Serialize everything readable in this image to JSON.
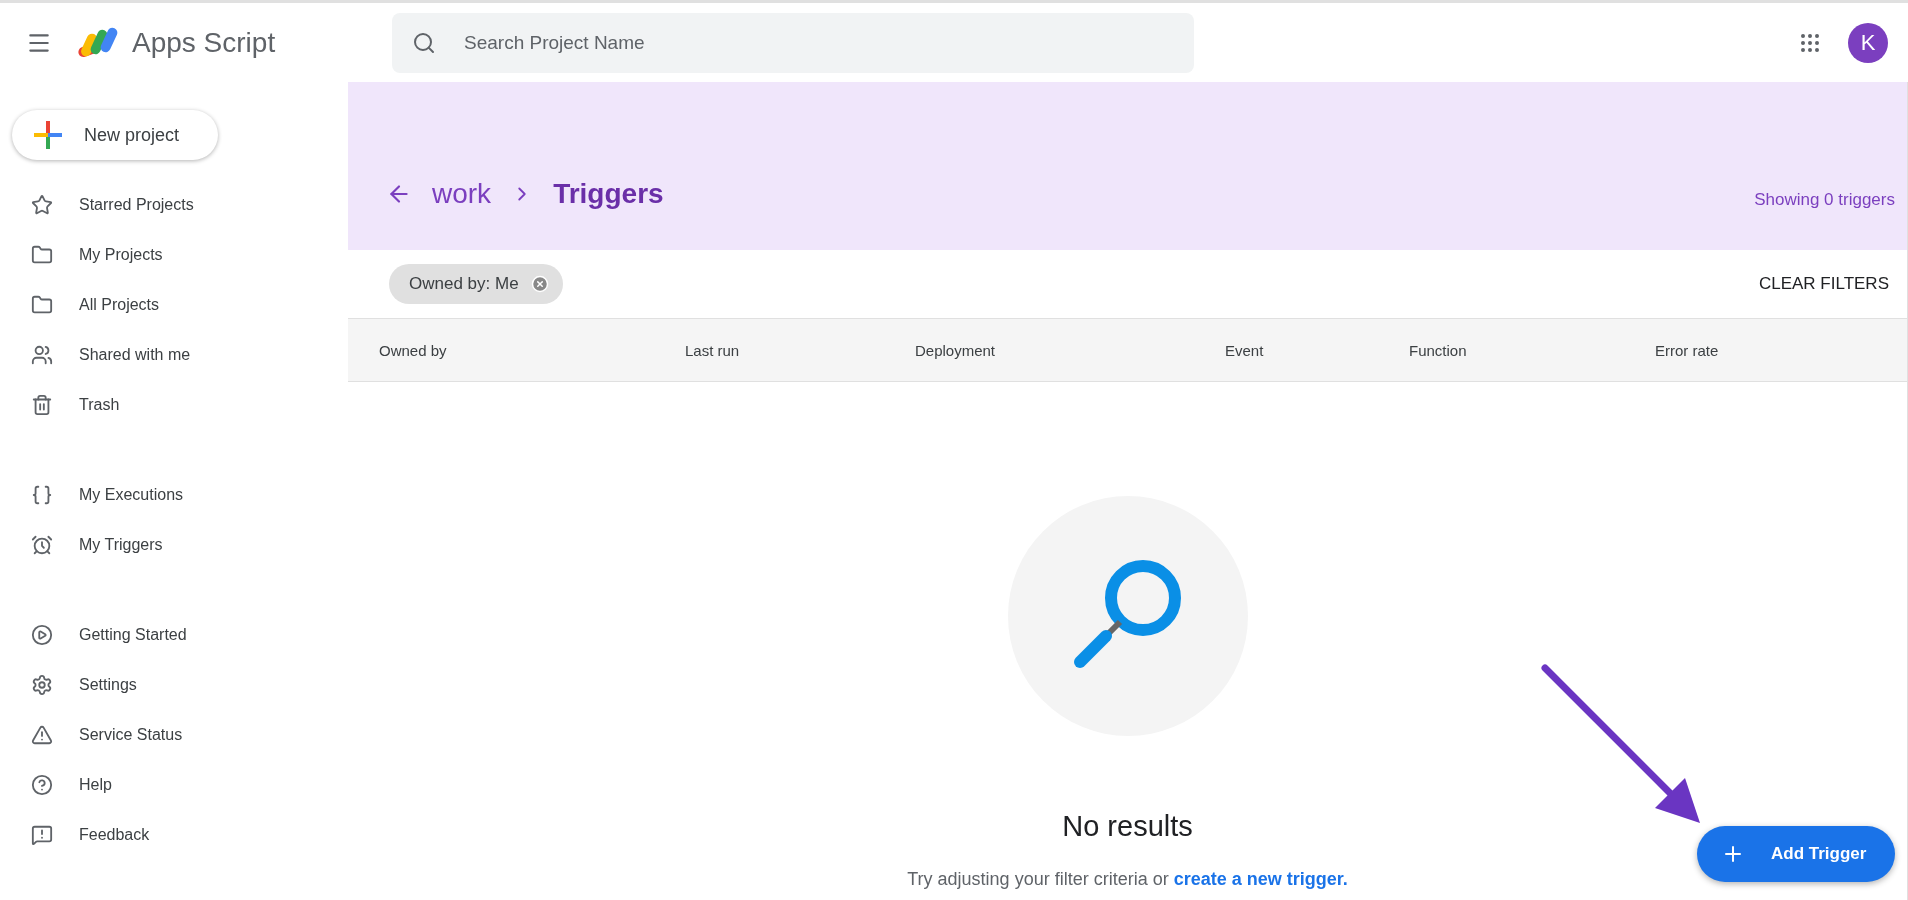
{
  "app": {
    "name": "Apps Script"
  },
  "search": {
    "placeholder": "Search Project Name"
  },
  "account": {
    "initial": "K"
  },
  "new_project": {
    "label": "New project"
  },
  "sidebar": {
    "groups": [
      {
        "items": [
          {
            "label": "Starred Projects"
          },
          {
            "label": "My Projects"
          },
          {
            "label": "All Projects"
          },
          {
            "label": "Shared with me"
          },
          {
            "label": "Trash"
          }
        ]
      },
      {
        "items": [
          {
            "label": "My Executions"
          },
          {
            "label": "My Triggers"
          }
        ]
      },
      {
        "items": [
          {
            "label": "Getting Started"
          },
          {
            "label": "Settings"
          },
          {
            "label": "Service Status"
          },
          {
            "label": "Help"
          },
          {
            "label": "Feedback"
          }
        ]
      }
    ]
  },
  "breadcrumb": {
    "parent": "work",
    "current": "Triggers"
  },
  "count": "Showing 0 triggers",
  "filters": [
    {
      "label": "Owned by: Me"
    }
  ],
  "clear_filters": "CLEAR FILTERS",
  "table": {
    "columns": [
      "Owned by",
      "Last run",
      "Deployment",
      "Event",
      "Function",
      "Error rate"
    ]
  },
  "empty": {
    "title": "No results",
    "hint": "Try adjusting your filter criteria or ",
    "link": "create a new trigger."
  },
  "add_button": {
    "label": "Add Trigger"
  }
}
